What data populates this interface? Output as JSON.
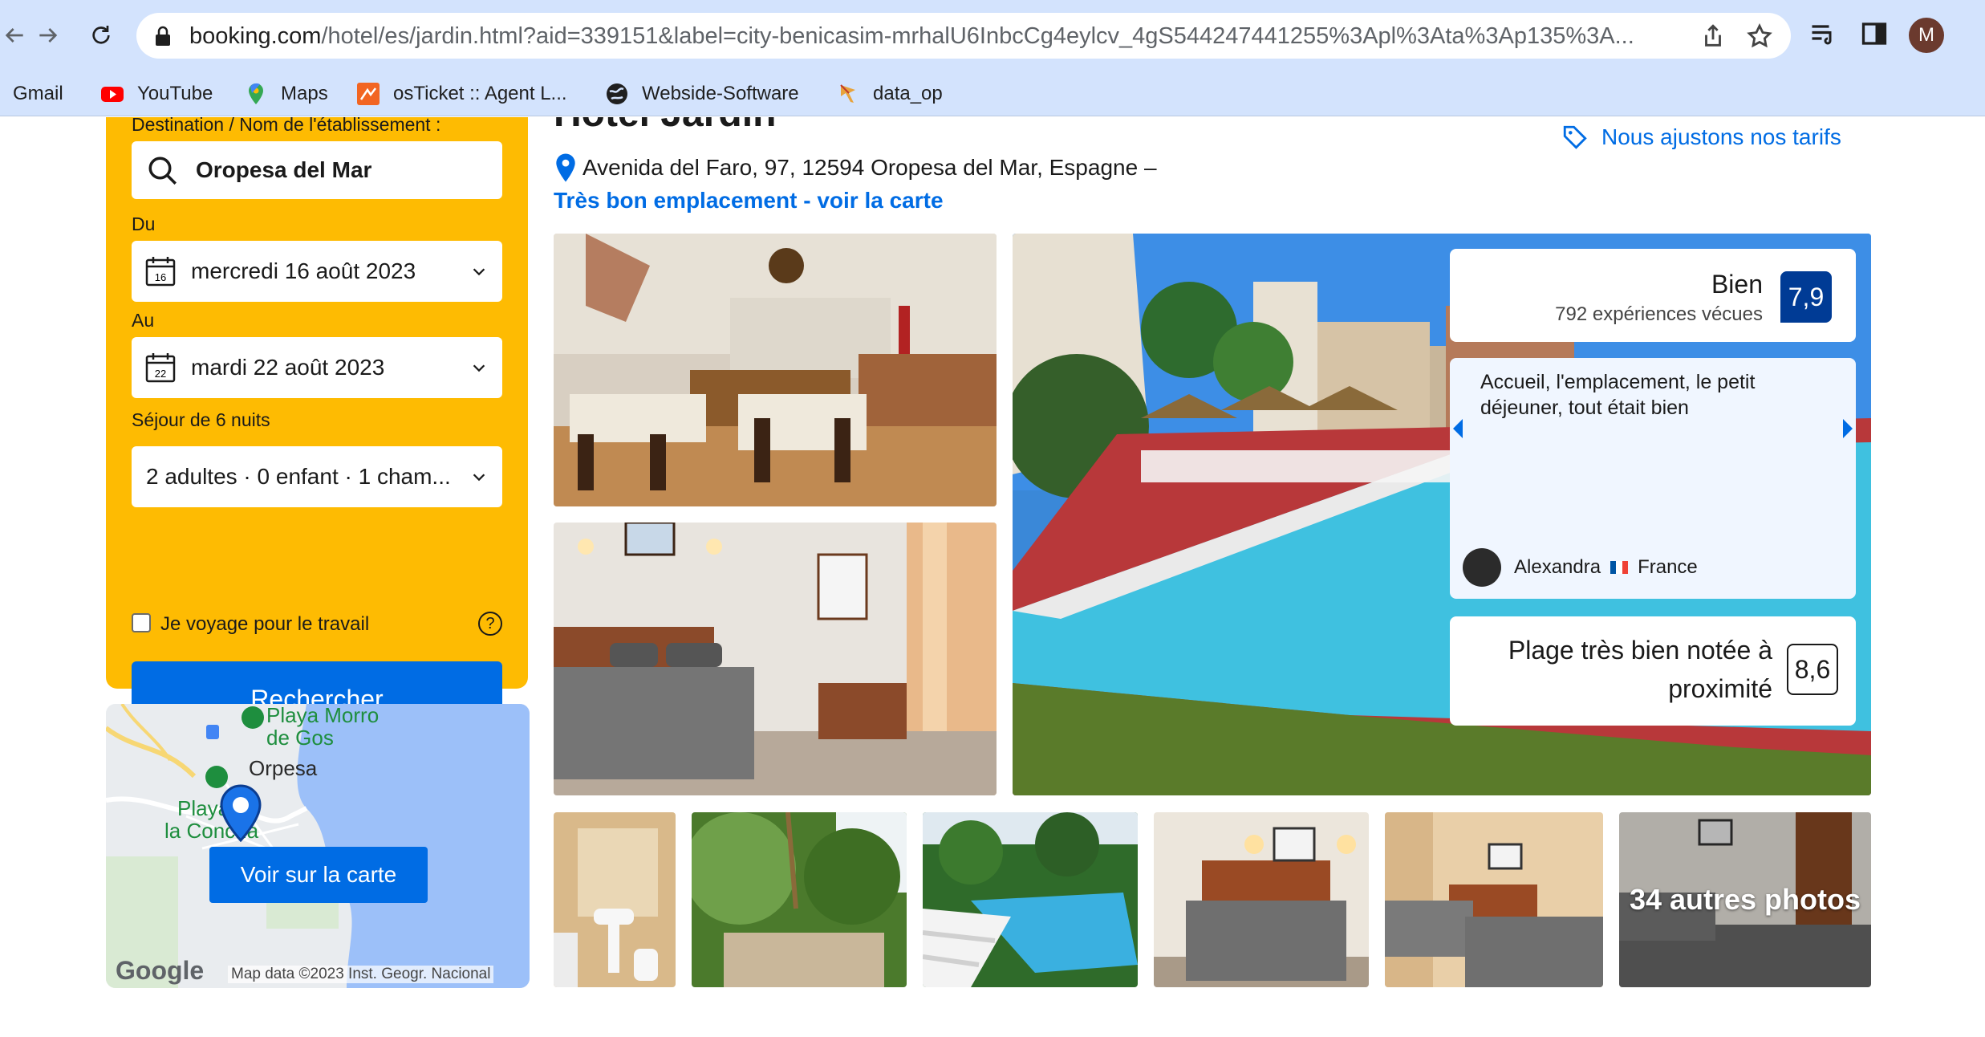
{
  "browser": {
    "url_domain": "booking.com",
    "url_path": "/hotel/es/jardin.html?aid=339151&label=city-benicasim-mrhalU6InbcCg4eylcv_4gS544247441255%3Apl%3Ata%3Ap135%3A...",
    "profile_initial": "M",
    "bookmarks": [
      "Gmail",
      "YouTube",
      "Maps",
      "osTicket :: Agent L...",
      "Webside-Software",
      "data_op"
    ]
  },
  "search": {
    "destination_label": "Destination / Nom de l'établissement :",
    "destination_value": "Oropesa del Mar",
    "from_label": "Du",
    "from_value": "mercredi 16 août 2023",
    "from_day": "16",
    "to_label": "Au",
    "to_value": "mardi 22 août 2023",
    "to_day": "22",
    "stay_label": "Séjour de 6 nuits",
    "guests_value": "2 adultes · 0 enfant · 1 cham...",
    "work_label": "Je voyage pour le travail",
    "help_symbol": "?",
    "button_label": "Rechercher"
  },
  "map": {
    "button_label": "Voir sur la carte",
    "attribution": "Map data ©2023 Inst. Geogr. Nacional",
    "google": "Google",
    "labels": [
      "Playa Morro",
      "de Gos",
      "Orpesa",
      "Playa de",
      "la Concha"
    ]
  },
  "hotel": {
    "title": "Hotel Jardín",
    "price_match": "Nous ajustons nos tarifs",
    "address": "Avenida del Faro, 97, 12594 Oropesa del Mar, Espagne –",
    "location_link": "Très bon emplacement - voir la carte"
  },
  "reviews": {
    "rating_word": "Bien",
    "rating_count": "792 expériences vécues",
    "score": "7,9",
    "quote": "Accueil, l'emplacement, le petit déjeuner, tout était bien",
    "reviewer_name": "Alexandra",
    "reviewer_country": "France",
    "beach_text": "Plage très bien notée à proximité",
    "beach_score": "8,6"
  },
  "gallery": {
    "more_photos": "34 autres photos"
  },
  "colors": {
    "accent": "#006ce4",
    "search_panel": "#febb02",
    "score_bg": "#003b95",
    "chrome_bar": "#d3e3fd"
  }
}
